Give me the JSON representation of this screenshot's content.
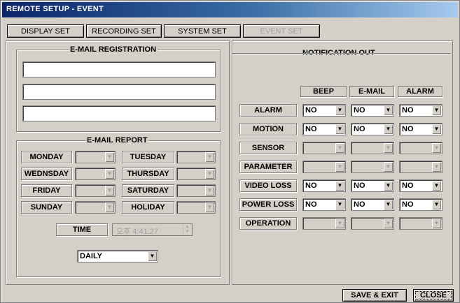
{
  "window": {
    "title": "REMOTE SETUP  -  EVENT"
  },
  "tabs": [
    {
      "label": "DISPLAY SET",
      "enabled": true
    },
    {
      "label": "RECORDING SET",
      "enabled": true
    },
    {
      "label": "SYSTEM SET",
      "enabled": true
    },
    {
      "label": "EVENT SET",
      "enabled": false
    }
  ],
  "email_registration": {
    "title": "E-MAIL REGISTRATION",
    "fields": [
      "",
      "",
      ""
    ]
  },
  "email_report": {
    "title": "E-MAIL REPORT",
    "days": [
      {
        "label": "MONDAY",
        "value": ""
      },
      {
        "label": "TUESDAY",
        "value": ""
      },
      {
        "label": "WEDNSDAY",
        "value": ""
      },
      {
        "label": "THURSDAY",
        "value": ""
      },
      {
        "label": "FRIDAY",
        "value": ""
      },
      {
        "label": "SATURDAY",
        "value": ""
      },
      {
        "label": "SUNDAY",
        "value": ""
      },
      {
        "label": "HOLIDAY",
        "value": ""
      }
    ],
    "time_label": "TIME",
    "time_value": "오후  4:41:27",
    "frequency": "DAILY"
  },
  "notification_out": {
    "title": "NOTIFICATION OUT",
    "columns": [
      "BEEP",
      "E-MAIL",
      "ALARM"
    ],
    "rows": [
      {
        "label": "ALARM",
        "enabled": true,
        "values": [
          "NO",
          "NO",
          "NO"
        ]
      },
      {
        "label": "MOTION",
        "enabled": true,
        "values": [
          "NO",
          "NO",
          "NO"
        ]
      },
      {
        "label": "SENSOR",
        "enabled": false,
        "values": [
          "",
          "",
          ""
        ]
      },
      {
        "label": "PARAMETER",
        "enabled": false,
        "values": [
          "",
          "",
          ""
        ]
      },
      {
        "label": "VIDEO LOSS",
        "enabled": true,
        "values": [
          "NO",
          "NO",
          "NO"
        ]
      },
      {
        "label": "POWER LOSS",
        "enabled": true,
        "values": [
          "NO",
          "NO",
          "NO"
        ]
      },
      {
        "label": "OPERATION",
        "enabled": false,
        "values": [
          "",
          "",
          ""
        ]
      }
    ]
  },
  "buttons": {
    "save_exit": "SAVE & EXIT",
    "close": "CLOSE"
  }
}
